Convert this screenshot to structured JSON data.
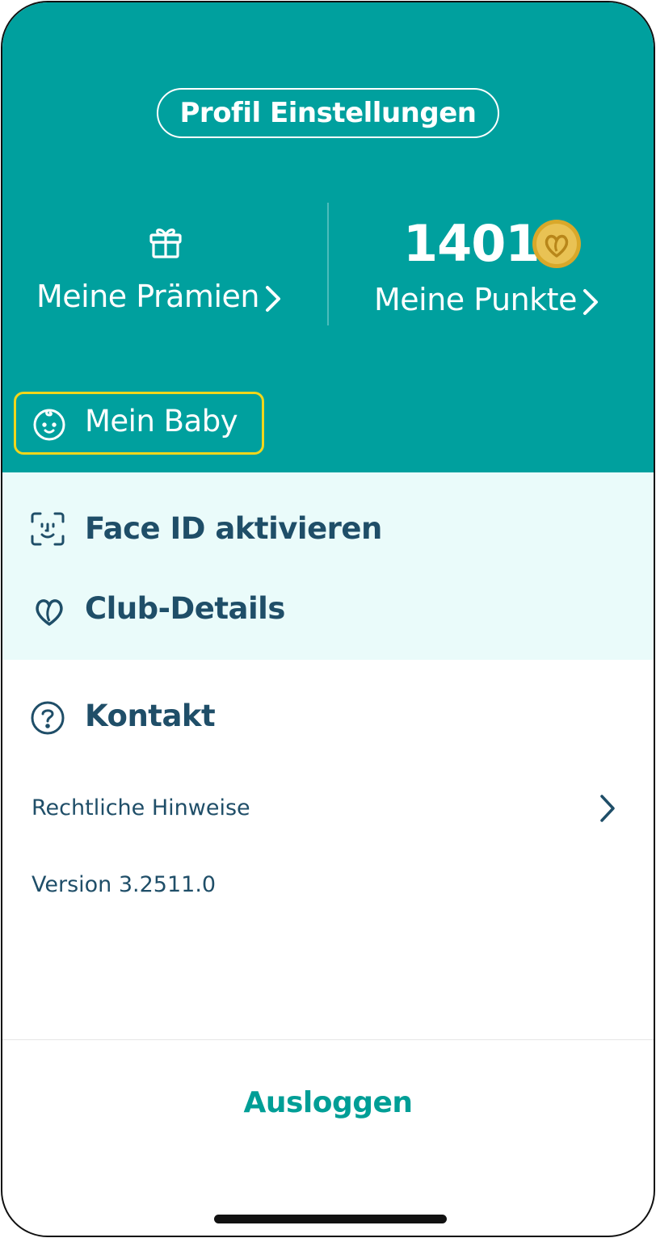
{
  "header": {
    "profile_button": "Profil Einstellungen",
    "rewards_label": "Meine Prämien",
    "points_value": "1401",
    "points_label": "Meine Punkte",
    "baby_label": "Mein Baby"
  },
  "menu": {
    "face_id": "Face ID aktivieren",
    "club_details": "Club-Details",
    "contact": "Kontakt",
    "legal": "Rechtliche Hinweise",
    "version": "Version 3.2511.0"
  },
  "footer": {
    "logout": "Ausloggen"
  },
  "colors": {
    "brand_teal": "#00a09e",
    "light_section": "#eafbfa",
    "text_dark": "#1f4e68",
    "highlight_border": "#f2d61b",
    "coin_gold": "#d9a82a"
  },
  "icons": [
    "gift-icon",
    "chevron-right-icon",
    "coin-icon",
    "baby-face-icon",
    "face-id-icon",
    "club-heart-icon",
    "help-circle-icon"
  ]
}
